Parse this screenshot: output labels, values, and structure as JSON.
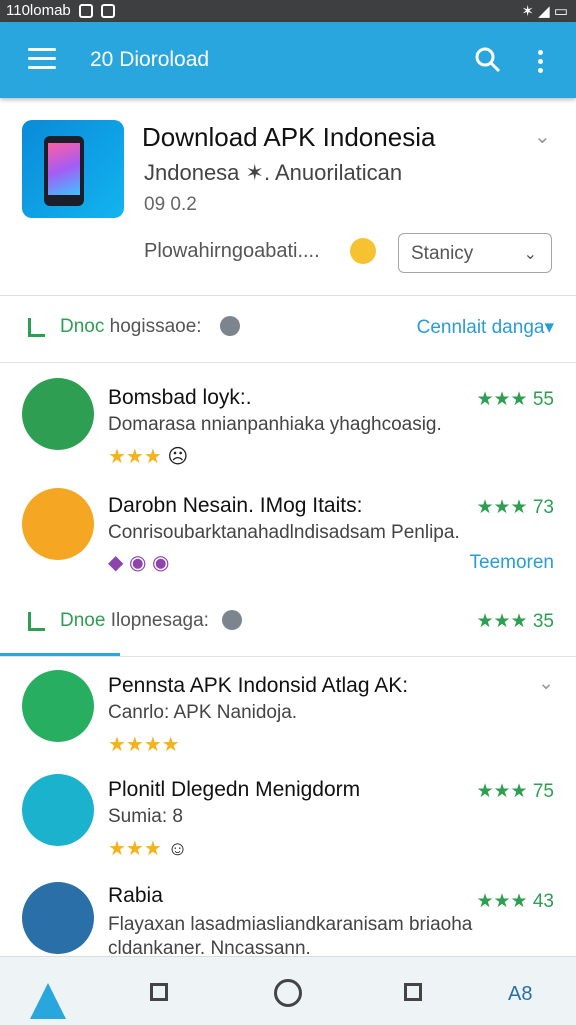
{
  "status_bar": {
    "left_text": "110lomab",
    "right_text": "✶ ◢ ▭",
    "battery": "▭"
  },
  "app_bar": {
    "title": "20 Dioroload",
    "accent_color": "#2aa6de"
  },
  "header": {
    "title": "Download APK Indonesia",
    "subtitle": "Jndonesa ✶. Anuorilatican",
    "version": "09 0.2",
    "download_text": "Plowahirngoabati....",
    "select_value": "Stanicy"
  },
  "sections": [
    {
      "label_green": "Dnoc",
      "label_dark": "hogissaoe:",
      "link": "Cennlait danga▾"
    },
    {
      "label_green": "Dnoe",
      "label_dark": "Ilopnesaga:",
      "rating": "★★★ 35"
    }
  ],
  "items": [
    {
      "name": "Bomsbad loyk:.",
      "desc": "Domarasa nnianpanhiaka yhaghcoasig.",
      "stars": "★★★",
      "extra": "☹",
      "rating": "★★★ 55"
    },
    {
      "name": "Darobn Nesain. IMog Itaits:",
      "desc": "Conrisoubarktanahadlndisadsam Penlipa.",
      "stars": "◆ ◉ ◉",
      "rating": "★★★ 73",
      "link": "Teemoren"
    },
    {
      "name": "Pennsta APK Indonsid Atlag AK:",
      "desc": "Canrlo: APK Nanidoja.",
      "stars": "★★★★"
    },
    {
      "name": "Plonitl Dlegedn Menigdorm",
      "desc": "Sumia: 8",
      "stars": "★★★",
      "extra": "☺",
      "rating": "★★★ 75"
    },
    {
      "name": "Rabia",
      "desc": "Flayaxan lasadmiasliandkaranisam briaoha",
      "desc2": "cldankaner. Nncassann.",
      "rating": "★★★ 43"
    }
  ],
  "nav_bar": {
    "right_text": "A8"
  }
}
